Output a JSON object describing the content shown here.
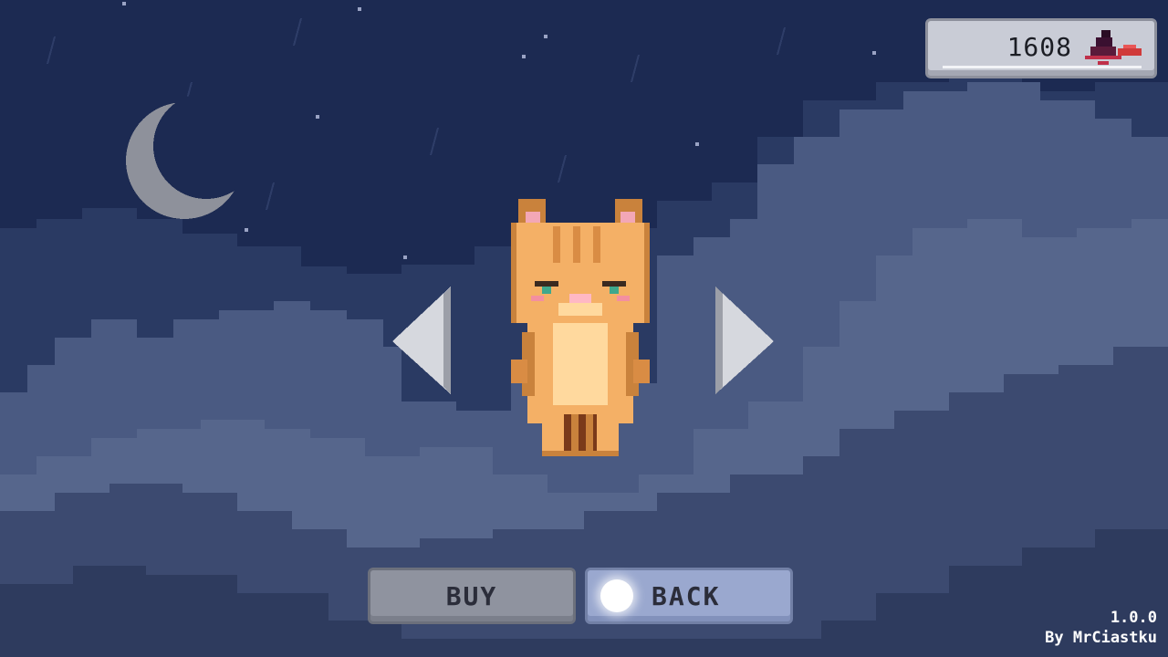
{
  "hud": {
    "currency_amount": "1608",
    "currency_icon": "witch-hat-shoe-icon"
  },
  "shop": {
    "selected_skin": "orange-tabby-cat",
    "prev_icon": "triangle-left-icon",
    "next_icon": "triangle-right-icon"
  },
  "buttons": {
    "buy_label": "BUY",
    "back_label": "BACK"
  },
  "footer": {
    "version": "1.0.0",
    "credit": "By MrCiastku"
  },
  "colors": {
    "sky": "#1c2a52",
    "cloud_dark": "#2f4066",
    "cloud_mid": "#45557c",
    "cloud_light": "#5c6b90",
    "cat_fur": "#f4b066",
    "cat_belly": "#ffd99e"
  }
}
